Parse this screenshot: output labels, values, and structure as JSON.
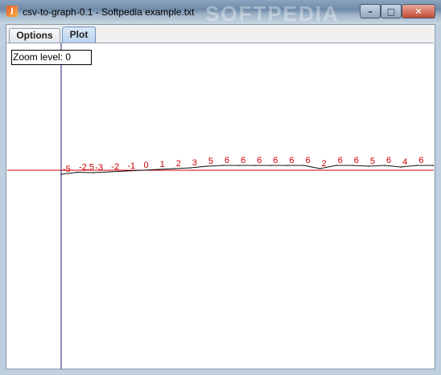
{
  "window": {
    "title": "csv-to-graph-0.1 - Softpedia example.txt",
    "watermark": "SOFTPEDIA",
    "app_icon_glyph": "J"
  },
  "controls": {
    "minimize": "–",
    "maximize": "□",
    "close": "✕"
  },
  "tabs": [
    {
      "label": "Options",
      "selected": false
    },
    {
      "label": "Plot",
      "selected": true
    }
  ],
  "zoom": {
    "label": "Zoom level: 0"
  },
  "colors": {
    "axis_vertical": "#1a1a7a",
    "axis_horizontal": "#cc0000",
    "series_line": "#111111",
    "value_labels": "#cc0000"
  },
  "chart_data": {
    "type": "line",
    "values": [
      -5,
      -2.5,
      -3,
      -2,
      -1,
      0,
      1,
      2,
      3,
      5,
      6,
      6,
      6,
      6,
      6,
      6,
      2,
      6,
      6,
      5,
      6,
      4,
      6,
      6
    ],
    "value_labels": [
      "-5",
      "-2.5",
      "-3",
      "-2",
      "-1",
      "0",
      "1",
      "2",
      "3",
      "5",
      "6",
      "6",
      "6",
      "6",
      "6",
      "6",
      "2",
      "6",
      "6",
      "5",
      "6",
      "4",
      "6",
      "6"
    ],
    "grid": false
  }
}
